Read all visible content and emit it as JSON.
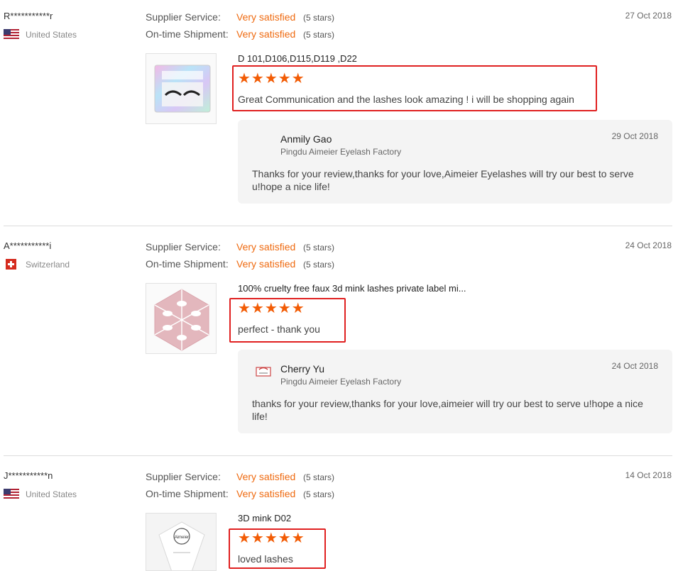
{
  "reviews": [
    {
      "buyer": "R***********r",
      "country": "United States",
      "flag": "us-flag-icon",
      "date": "27 Oct 2018",
      "supplier_label": "Supplier Service:",
      "supplier_value": "Very satisfied",
      "supplier_stars": "(5 stars)",
      "shipment_label": "On-time Shipment:",
      "shipment_value": "Very satisfied",
      "shipment_stars": "(5 stars)",
      "product": "D 101,D106,D115,D119 ,D22",
      "stars": "★★★★★",
      "rating": 5,
      "comment": "Great Communication and the lashes look amazing ! i will be shopping again",
      "reply": {
        "name": "Anmily Gao",
        "company": "Pingdu Aimeier Eyelash Factory",
        "date": "29 Oct 2018",
        "text": "Thanks for your review,thanks for your love,Aimeier Eyelashes will try our best to serve u!hope a nice life!"
      }
    },
    {
      "buyer": "A***********i",
      "country": "Switzerland",
      "flag": "swiss-flag-icon",
      "date": "24 Oct 2018",
      "supplier_label": "Supplier Service:",
      "supplier_value": "Very satisfied",
      "supplier_stars": "(5 stars)",
      "shipment_label": "On-time Shipment:",
      "shipment_value": "Very satisfied",
      "shipment_stars": "(5 stars)",
      "product": "100% cruelty free faux 3d mink lashes private label mi...",
      "stars": "★★★★★",
      "rating": 5,
      "comment": "perfect - thank you",
      "reply": {
        "name": "Cherry Yu",
        "company": "Pingdu Aimeier Eyelash Factory",
        "date": "24 Oct 2018",
        "text": "thanks for your review,thanks for your love,aimeier will try our best to serve u!hope a nice life!"
      }
    },
    {
      "buyer": "J***********n",
      "country": "United States",
      "flag": "us-flag-icon",
      "date": "14 Oct 2018",
      "supplier_label": "Supplier Service:",
      "supplier_value": "Very satisfied",
      "supplier_stars": "(5 stars)",
      "shipment_label": "On-time Shipment:",
      "shipment_value": "Very satisfied",
      "shipment_stars": "(5 stars)",
      "product": "3D mink D02",
      "stars": "★★★★★",
      "rating": 5,
      "comment": "loved lashes",
      "thumb_brand": "Aimeier"
    }
  ],
  "colors": {
    "accent": "#ef6a10",
    "stars": "#f25c05",
    "highlight": "#e02020"
  }
}
